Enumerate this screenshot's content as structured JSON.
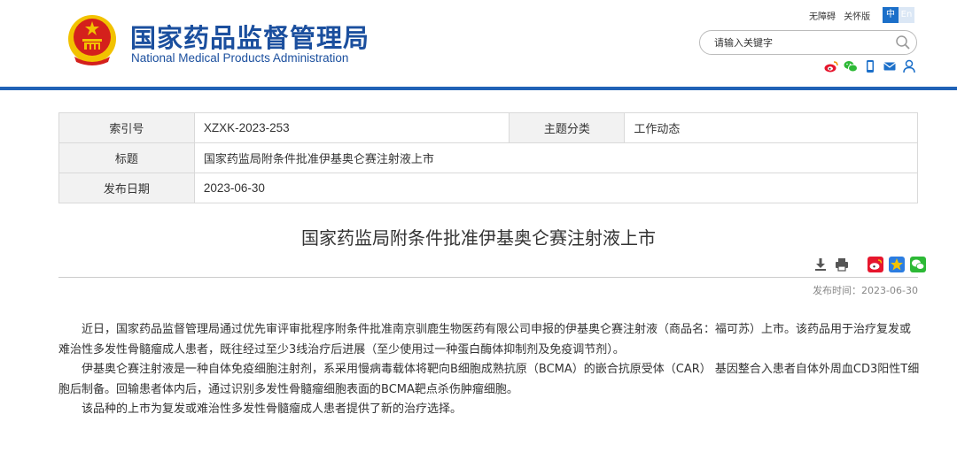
{
  "header": {
    "name_cn": "国家药品监督管理局",
    "name_en": "National Medical Products Administration",
    "links": [
      "无障碍",
      "关怀版"
    ],
    "lang_zh": "中",
    "lang_en": "En",
    "search_placeholder": "请输入关键字",
    "social_icons": [
      "weibo-icon",
      "wechat-icon",
      "mobile-icon",
      "mail-icon",
      "user-icon"
    ]
  },
  "info": {
    "index_label": "索引号",
    "index_value": "XZXK-2023-253",
    "category_label": "主题分类",
    "category_value": "工作动态",
    "title_label": "标题",
    "title_value": "国家药监局附条件批准伊基奥仑赛注射液上市",
    "date_label": "发布日期",
    "date_value": "2023-06-30"
  },
  "article": {
    "title": "国家药监局附条件批准伊基奥仑赛注射液上市",
    "publish_time": "发布时间：2023-06-30",
    "paragraphs": [
      "近日，国家药品监督管理局通过优先审评审批程序附条件批准南京驯鹿生物医药有限公司申报的伊基奥仑赛注射液（商品名：福可苏）上市。该药品用于治疗复发或难治性多发性骨髓瘤成人患者，既往经过至少3线治疗后进展（至少使用过一种蛋白酶体抑制剂及免疫调节剂）。",
      "伊基奥仑赛注射液是一种自体免疫细胞注射剂，系采用慢病毒载体将靶向B细胞成熟抗原（BCMA）的嵌合抗原受体（CAR） 基因整合入患者自体外周血CD3阳性T细胞后制备。回输患者体内后，通过识别多发性骨髓瘤细胞表面的BCMA靶点杀伤肿瘤细胞。",
      "该品种的上市为复发或难治性多发性骨髓瘤成人患者提供了新的治疗选择。"
    ]
  },
  "colors": {
    "brand_blue": "#1b4f9e",
    "bar_blue": "#2062b6",
    "emblem_red": "#d4201c",
    "emblem_gold": "#f2c200"
  }
}
